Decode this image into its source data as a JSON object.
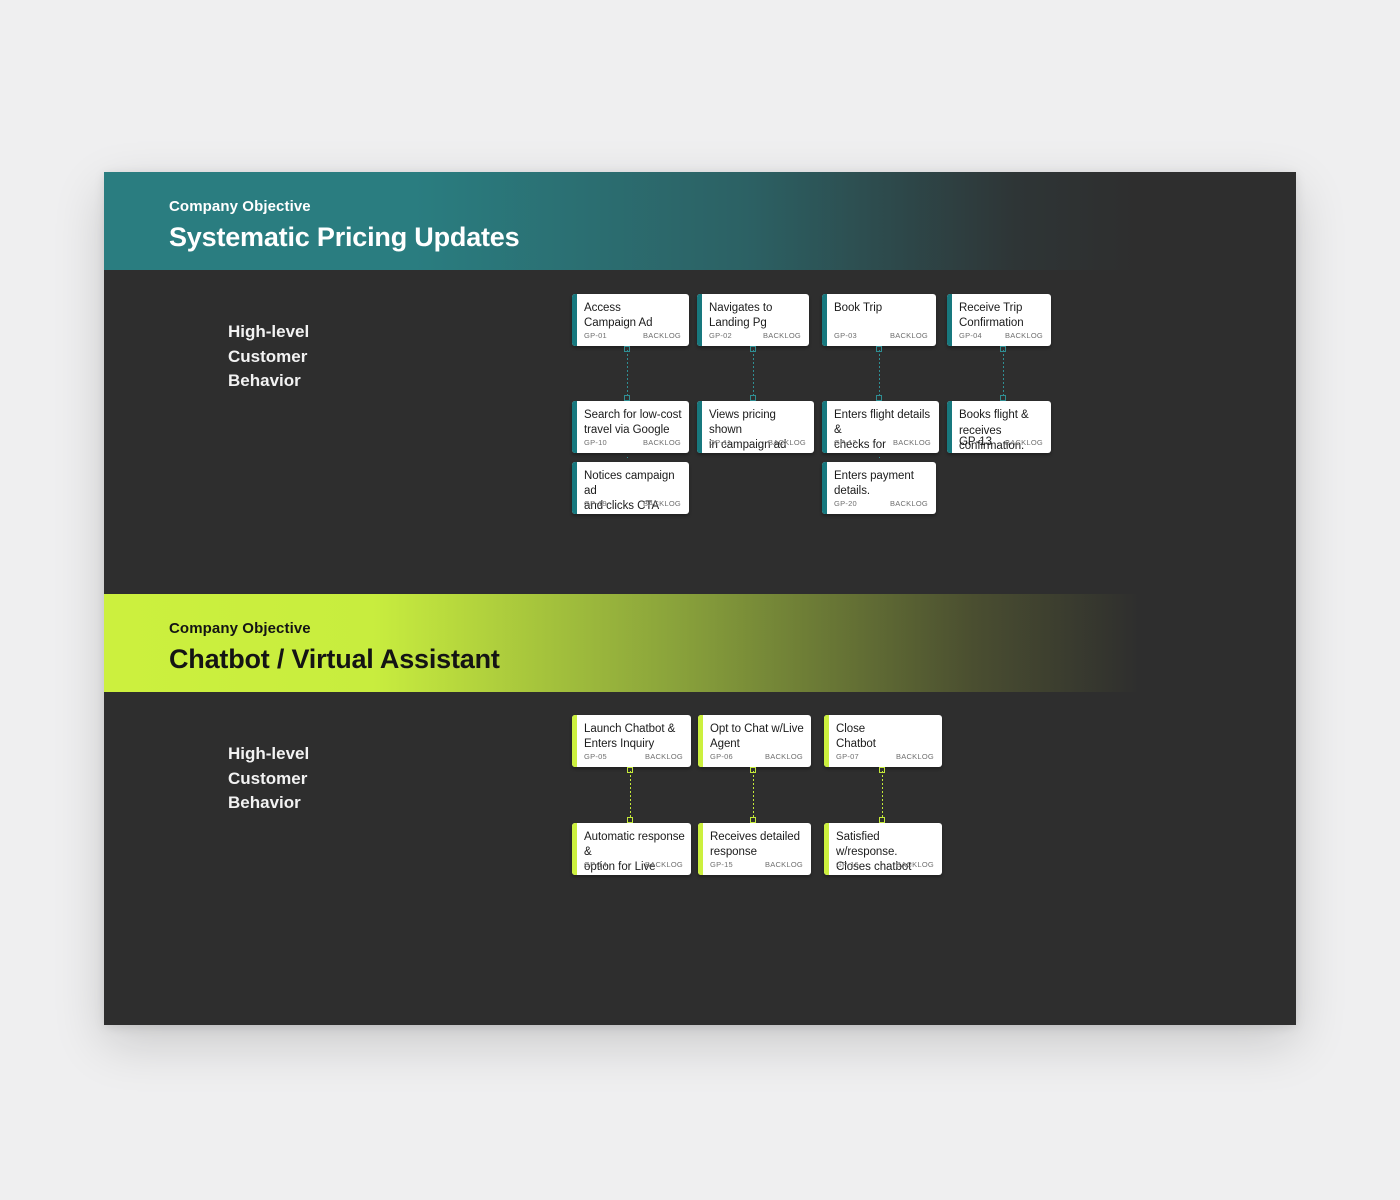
{
  "board": {
    "background_color": "#2e2e2e",
    "page_background": "#efeff0"
  },
  "sections": [
    {
      "id": "systematic-pricing-updates",
      "kicker": "Company Objective",
      "title": "Systematic Pricing Updates",
      "accent_color": "#2a7d80",
      "card_accent_color": "#17787e",
      "connector_color": "#2f8e93",
      "header_text_color": "#ffffff",
      "lane_label": "High-level\nCustomer\nBehavior",
      "columns": [
        {
          "cards": [
            {
              "title": "Access\nCampaign Ad",
              "id": "GP-01",
              "status": "BACKLOG"
            },
            {
              "title": "Search for low-cost\ntravel via Google",
              "id": "GP-10",
              "status": "BACKLOG"
            },
            {
              "title": "Notices campaign ad\nand clicks CTA",
              "id": "GP-19",
              "status": "BACKLOG"
            }
          ]
        },
        {
          "cards": [
            {
              "title": "Navigates to\nLanding Pg",
              "id": "GP-02",
              "status": "BACKLOG"
            },
            {
              "title": "Views pricing shown\nin campaign ad",
              "id": "GP-11",
              "status": "BACKLOG"
            }
          ]
        },
        {
          "cards": [
            {
              "title": "Book Trip",
              "id": "GP-03",
              "status": "BACKLOG"
            },
            {
              "title": "Enters flight details &\nchecks for availability.",
              "id": "GP-12",
              "status": "BACKLOG"
            },
            {
              "title": "Enters payment\ndetails.",
              "id": "GP-20",
              "status": "BACKLOG"
            }
          ]
        },
        {
          "cards": [
            {
              "title": "Receive Trip\nConfirmation",
              "id": "GP-04",
              "status": "BACKLOG"
            },
            {
              "title": "Books flight &\nreceives\nconfirmation.",
              "id": "GP-13",
              "status": "BACKLOG"
            }
          ]
        }
      ]
    },
    {
      "id": "chatbot-virtual-assistant",
      "kicker": "Company Objective",
      "title": "Chatbot / Virtual Assistant",
      "accent_color": "#ccf03e",
      "card_accent_color": "#ccf03e",
      "connector_color": "#c3e83a",
      "header_text_color": "#141414",
      "lane_label": "High-level\nCustomer\nBehavior",
      "columns": [
        {
          "cards": [
            {
              "title": "Launch Chatbot &\nEnters Inquiry",
              "id": "GP-05",
              "status": "BACKLOG"
            },
            {
              "title": "Automatic response &\noption for Live Agent",
              "id": "GP-14",
              "status": "BACKLOG"
            }
          ]
        },
        {
          "cards": [
            {
              "title": "Opt to Chat w/Live\nAgent",
              "id": "GP-06",
              "status": "BACKLOG"
            },
            {
              "title": "Receives detailed\nresponse",
              "id": "GP-15",
              "status": "BACKLOG"
            }
          ]
        },
        {
          "cards": [
            {
              "title": "Close\nChatbot",
              "id": "GP-07",
              "status": "BACKLOG"
            },
            {
              "title": "Satisfied w/response.\nCloses chatbot",
              "id": "GP-16",
              "status": "BACKLOG"
            }
          ]
        }
      ]
    }
  ]
}
